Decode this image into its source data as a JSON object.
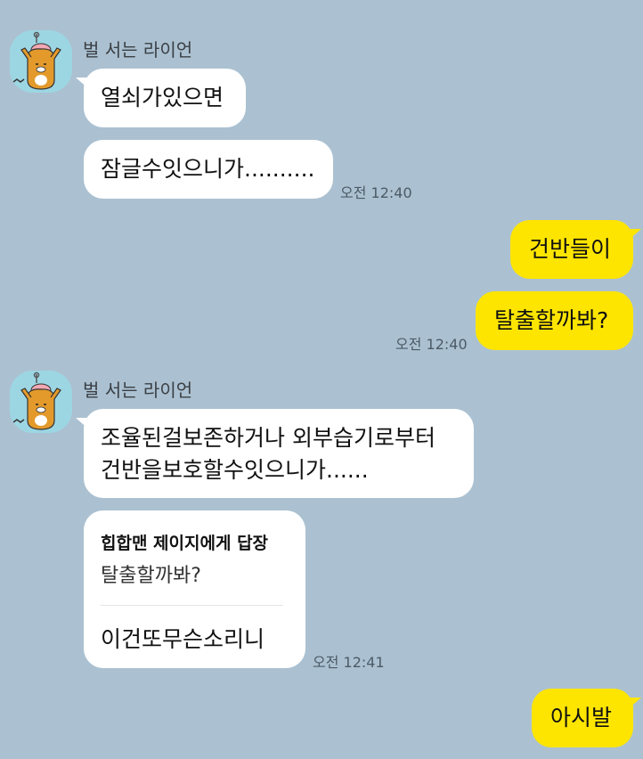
{
  "colors": {
    "background": "#abc1d1",
    "incoming_bubble": "#ffffff",
    "outgoing_bubble": "#fee500",
    "avatar_bg": "#9dd6e3"
  },
  "groups": [
    {
      "type": "incoming",
      "sender": "벌 서는 라이언",
      "avatar_icon": "ryan-avatar-icon",
      "messages": [
        "열쇠가있으면",
        "잠글수잇으니가.........."
      ],
      "time": "오전 12:40"
    },
    {
      "type": "outgoing",
      "messages": [
        "건반들이",
        "탈출할까봐?"
      ],
      "time": "오전 12:40"
    },
    {
      "type": "incoming",
      "sender": "벌 서는 라이언",
      "avatar_icon": "ryan-avatar-icon",
      "messages": [
        "조율된걸보존하거나 외부습기로부터",
        "건반을보호할수잇으니가......"
      ],
      "reply": {
        "title": "힙합맨 제이지에게 답장",
        "quote": "탈출할까봐?",
        "text": "이건또무슨소리니"
      },
      "time": "오전 12:41"
    },
    {
      "type": "outgoing",
      "messages": [
        "아시발"
      ]
    }
  ]
}
